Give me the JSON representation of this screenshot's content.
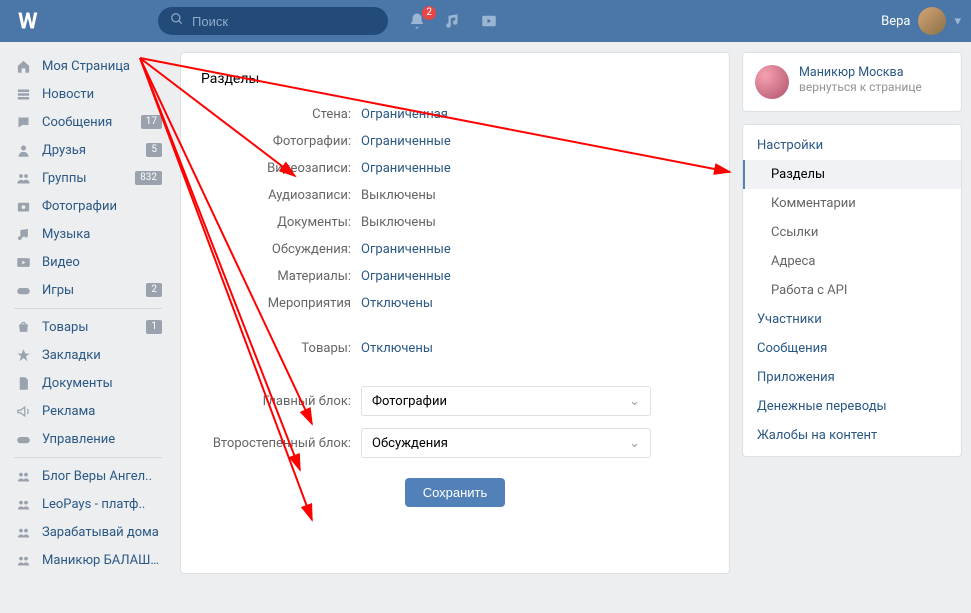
{
  "header": {
    "search_placeholder": "Поиск",
    "notif_count": "2",
    "username": "Вера"
  },
  "sidebar": {
    "items": [
      {
        "icon": "home",
        "label": "Моя Страница",
        "badge": null
      },
      {
        "icon": "feed",
        "label": "Новости",
        "badge": null
      },
      {
        "icon": "msg",
        "label": "Сообщения",
        "badge": "17"
      },
      {
        "icon": "friends",
        "label": "Друзья",
        "badge": "5"
      },
      {
        "icon": "groups",
        "label": "Группы",
        "badge": "832"
      },
      {
        "icon": "photo",
        "label": "Фотографии",
        "badge": null
      },
      {
        "icon": "music",
        "label": "Музыка",
        "badge": null
      },
      {
        "icon": "video",
        "label": "Видео",
        "badge": null
      },
      {
        "icon": "games",
        "label": "Игры",
        "badge": "2"
      }
    ],
    "items2": [
      {
        "icon": "market",
        "label": "Товары",
        "badge": "1"
      },
      {
        "icon": "star",
        "label": "Закладки",
        "badge": null
      },
      {
        "icon": "doc",
        "label": "Документы",
        "badge": null
      },
      {
        "icon": "ads",
        "label": "Реклама",
        "badge": null
      },
      {
        "icon": "gamepad",
        "label": "Управление",
        "badge": null
      }
    ],
    "items3": [
      {
        "icon": "grp",
        "label": "Блог Веры Ангел..",
        "badge": null
      },
      {
        "icon": "grp",
        "label": "LeoPays - платф..",
        "badge": null
      },
      {
        "icon": "grp",
        "label": "Зарабатывай дома",
        "badge": null
      },
      {
        "icon": "grp",
        "label": "Маникюр БАЛАШИ..",
        "badge": null
      }
    ]
  },
  "main": {
    "title": "Разделы",
    "rows": [
      {
        "label": "Стена:",
        "value": "Ограниченная",
        "link": true
      },
      {
        "label": "Фотографии:",
        "value": "Ограниченные",
        "link": true
      },
      {
        "label": "Видеозаписи:",
        "value": "Ограниченные",
        "link": true
      },
      {
        "label": "Аудиозаписи:",
        "value": "Выключены",
        "link": false
      },
      {
        "label": "Документы:",
        "value": "Выключены",
        "link": false
      },
      {
        "label": "Обсуждения:",
        "value": "Ограниченные",
        "link": true
      },
      {
        "label": "Материалы:",
        "value": "Ограниченные",
        "link": true
      },
      {
        "label": "Мероприятия",
        "value": "Отключены",
        "link": true
      }
    ],
    "rows2": [
      {
        "label": "Товары:",
        "value": "Отключены",
        "link": true
      }
    ],
    "selects": [
      {
        "label": "Главный блок:",
        "value": "Фотографии"
      },
      {
        "label": "Второстепенный блок:",
        "value": "Обсуждения"
      }
    ],
    "save": "Сохранить"
  },
  "right": {
    "card_title": "Маникюр Москва",
    "card_sub": "вернуться к странице",
    "menu": [
      {
        "type": "item",
        "label": "Настройки"
      },
      {
        "type": "sub",
        "label": "Разделы",
        "active": true
      },
      {
        "type": "sub",
        "label": "Комментарии"
      },
      {
        "type": "sub",
        "label": "Ссылки"
      },
      {
        "type": "sub",
        "label": "Адреса"
      },
      {
        "type": "sub",
        "label": "Работа с API"
      },
      {
        "type": "item",
        "label": "Участники"
      },
      {
        "type": "item",
        "label": "Сообщения"
      },
      {
        "type": "item",
        "label": "Приложения"
      },
      {
        "type": "item",
        "label": "Денежные переводы"
      },
      {
        "type": "item",
        "label": "Жалобы на контент"
      }
    ]
  }
}
